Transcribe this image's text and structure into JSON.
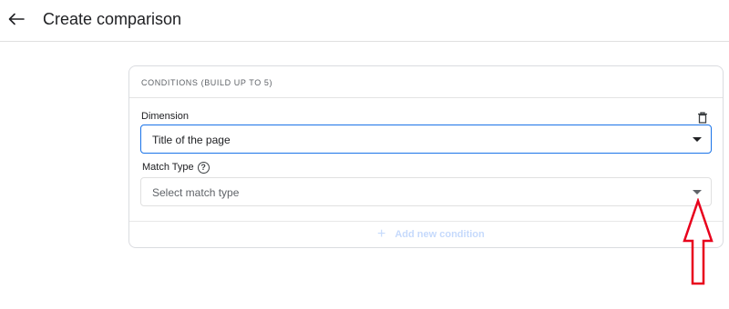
{
  "header": {
    "title": "Create comparison"
  },
  "conditions": {
    "heading": "CONDITIONS (BUILD UP TO 5)",
    "dimension": {
      "label": "Dimension",
      "value": "Title of the page"
    },
    "match_type": {
      "label": "Match Type",
      "help": "?",
      "placeholder": "Select match type"
    },
    "add_condition": {
      "icon": "+",
      "label": "Add new condition",
      "enabled": false
    }
  },
  "icons": {
    "back": "back-arrow-icon",
    "delete": "trash-icon",
    "help": "help-circle-icon",
    "dropdown": "caret-down-icon",
    "annotation": "red-outline-up-arrow"
  },
  "colors": {
    "accent": "#1a73e8",
    "disabled_accent": "#c6dafc",
    "annotation": "#e8001c"
  }
}
